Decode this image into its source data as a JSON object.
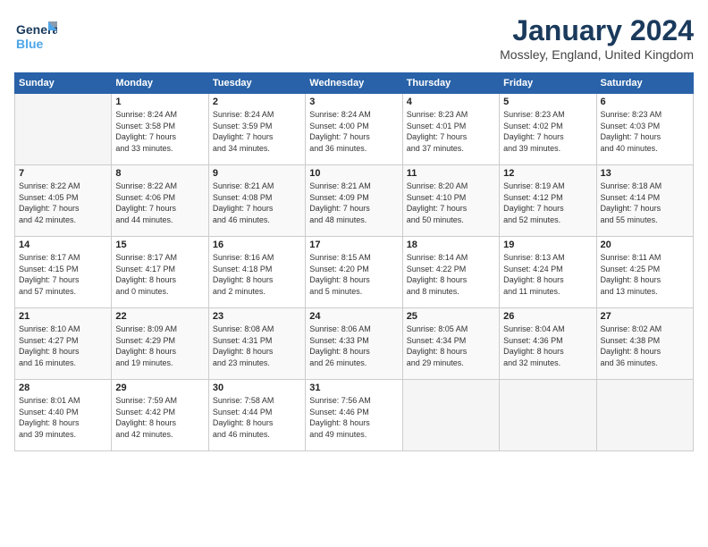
{
  "logo": {
    "line1": "General",
    "line2": "Blue"
  },
  "title": "January 2024",
  "location": "Mossley, England, United Kingdom",
  "days_header": [
    "Sunday",
    "Monday",
    "Tuesday",
    "Wednesday",
    "Thursday",
    "Friday",
    "Saturday"
  ],
  "weeks": [
    [
      {
        "num": "",
        "sunrise": "",
        "sunset": "",
        "daylight": ""
      },
      {
        "num": "1",
        "sunrise": "Sunrise: 8:24 AM",
        "sunset": "Sunset: 3:58 PM",
        "daylight": "Daylight: 7 hours and 33 minutes."
      },
      {
        "num": "2",
        "sunrise": "Sunrise: 8:24 AM",
        "sunset": "Sunset: 3:59 PM",
        "daylight": "Daylight: 7 hours and 34 minutes."
      },
      {
        "num": "3",
        "sunrise": "Sunrise: 8:24 AM",
        "sunset": "Sunset: 4:00 PM",
        "daylight": "Daylight: 7 hours and 36 minutes."
      },
      {
        "num": "4",
        "sunrise": "Sunrise: 8:23 AM",
        "sunset": "Sunset: 4:01 PM",
        "daylight": "Daylight: 7 hours and 37 minutes."
      },
      {
        "num": "5",
        "sunrise": "Sunrise: 8:23 AM",
        "sunset": "Sunset: 4:02 PM",
        "daylight": "Daylight: 7 hours and 39 minutes."
      },
      {
        "num": "6",
        "sunrise": "Sunrise: 8:23 AM",
        "sunset": "Sunset: 4:03 PM",
        "daylight": "Daylight: 7 hours and 40 minutes."
      }
    ],
    [
      {
        "num": "7",
        "sunrise": "Sunrise: 8:22 AM",
        "sunset": "Sunset: 4:05 PM",
        "daylight": "Daylight: 7 hours and 42 minutes."
      },
      {
        "num": "8",
        "sunrise": "Sunrise: 8:22 AM",
        "sunset": "Sunset: 4:06 PM",
        "daylight": "Daylight: 7 hours and 44 minutes."
      },
      {
        "num": "9",
        "sunrise": "Sunrise: 8:21 AM",
        "sunset": "Sunset: 4:08 PM",
        "daylight": "Daylight: 7 hours and 46 minutes."
      },
      {
        "num": "10",
        "sunrise": "Sunrise: 8:21 AM",
        "sunset": "Sunset: 4:09 PM",
        "daylight": "Daylight: 7 hours and 48 minutes."
      },
      {
        "num": "11",
        "sunrise": "Sunrise: 8:20 AM",
        "sunset": "Sunset: 4:10 PM",
        "daylight": "Daylight: 7 hours and 50 minutes."
      },
      {
        "num": "12",
        "sunrise": "Sunrise: 8:19 AM",
        "sunset": "Sunset: 4:12 PM",
        "daylight": "Daylight: 7 hours and 52 minutes."
      },
      {
        "num": "13",
        "sunrise": "Sunrise: 8:18 AM",
        "sunset": "Sunset: 4:14 PM",
        "daylight": "Daylight: 7 hours and 55 minutes."
      }
    ],
    [
      {
        "num": "14",
        "sunrise": "Sunrise: 8:17 AM",
        "sunset": "Sunset: 4:15 PM",
        "daylight": "Daylight: 7 hours and 57 minutes."
      },
      {
        "num": "15",
        "sunrise": "Sunrise: 8:17 AM",
        "sunset": "Sunset: 4:17 PM",
        "daylight": "Daylight: 8 hours and 0 minutes."
      },
      {
        "num": "16",
        "sunrise": "Sunrise: 8:16 AM",
        "sunset": "Sunset: 4:18 PM",
        "daylight": "Daylight: 8 hours and 2 minutes."
      },
      {
        "num": "17",
        "sunrise": "Sunrise: 8:15 AM",
        "sunset": "Sunset: 4:20 PM",
        "daylight": "Daylight: 8 hours and 5 minutes."
      },
      {
        "num": "18",
        "sunrise": "Sunrise: 8:14 AM",
        "sunset": "Sunset: 4:22 PM",
        "daylight": "Daylight: 8 hours and 8 minutes."
      },
      {
        "num": "19",
        "sunrise": "Sunrise: 8:13 AM",
        "sunset": "Sunset: 4:24 PM",
        "daylight": "Daylight: 8 hours and 11 minutes."
      },
      {
        "num": "20",
        "sunrise": "Sunrise: 8:11 AM",
        "sunset": "Sunset: 4:25 PM",
        "daylight": "Daylight: 8 hours and 13 minutes."
      }
    ],
    [
      {
        "num": "21",
        "sunrise": "Sunrise: 8:10 AM",
        "sunset": "Sunset: 4:27 PM",
        "daylight": "Daylight: 8 hours and 16 minutes."
      },
      {
        "num": "22",
        "sunrise": "Sunrise: 8:09 AM",
        "sunset": "Sunset: 4:29 PM",
        "daylight": "Daylight: 8 hours and 19 minutes."
      },
      {
        "num": "23",
        "sunrise": "Sunrise: 8:08 AM",
        "sunset": "Sunset: 4:31 PM",
        "daylight": "Daylight: 8 hours and 23 minutes."
      },
      {
        "num": "24",
        "sunrise": "Sunrise: 8:06 AM",
        "sunset": "Sunset: 4:33 PM",
        "daylight": "Daylight: 8 hours and 26 minutes."
      },
      {
        "num": "25",
        "sunrise": "Sunrise: 8:05 AM",
        "sunset": "Sunset: 4:34 PM",
        "daylight": "Daylight: 8 hours and 29 minutes."
      },
      {
        "num": "26",
        "sunrise": "Sunrise: 8:04 AM",
        "sunset": "Sunset: 4:36 PM",
        "daylight": "Daylight: 8 hours and 32 minutes."
      },
      {
        "num": "27",
        "sunrise": "Sunrise: 8:02 AM",
        "sunset": "Sunset: 4:38 PM",
        "daylight": "Daylight: 8 hours and 36 minutes."
      }
    ],
    [
      {
        "num": "28",
        "sunrise": "Sunrise: 8:01 AM",
        "sunset": "Sunset: 4:40 PM",
        "daylight": "Daylight: 8 hours and 39 minutes."
      },
      {
        "num": "29",
        "sunrise": "Sunrise: 7:59 AM",
        "sunset": "Sunset: 4:42 PM",
        "daylight": "Daylight: 8 hours and 42 minutes."
      },
      {
        "num": "30",
        "sunrise": "Sunrise: 7:58 AM",
        "sunset": "Sunset: 4:44 PM",
        "daylight": "Daylight: 8 hours and 46 minutes."
      },
      {
        "num": "31",
        "sunrise": "Sunrise: 7:56 AM",
        "sunset": "Sunset: 4:46 PM",
        "daylight": "Daylight: 8 hours and 49 minutes."
      },
      {
        "num": "",
        "sunrise": "",
        "sunset": "",
        "daylight": ""
      },
      {
        "num": "",
        "sunrise": "",
        "sunset": "",
        "daylight": ""
      },
      {
        "num": "",
        "sunrise": "",
        "sunset": "",
        "daylight": ""
      }
    ]
  ]
}
